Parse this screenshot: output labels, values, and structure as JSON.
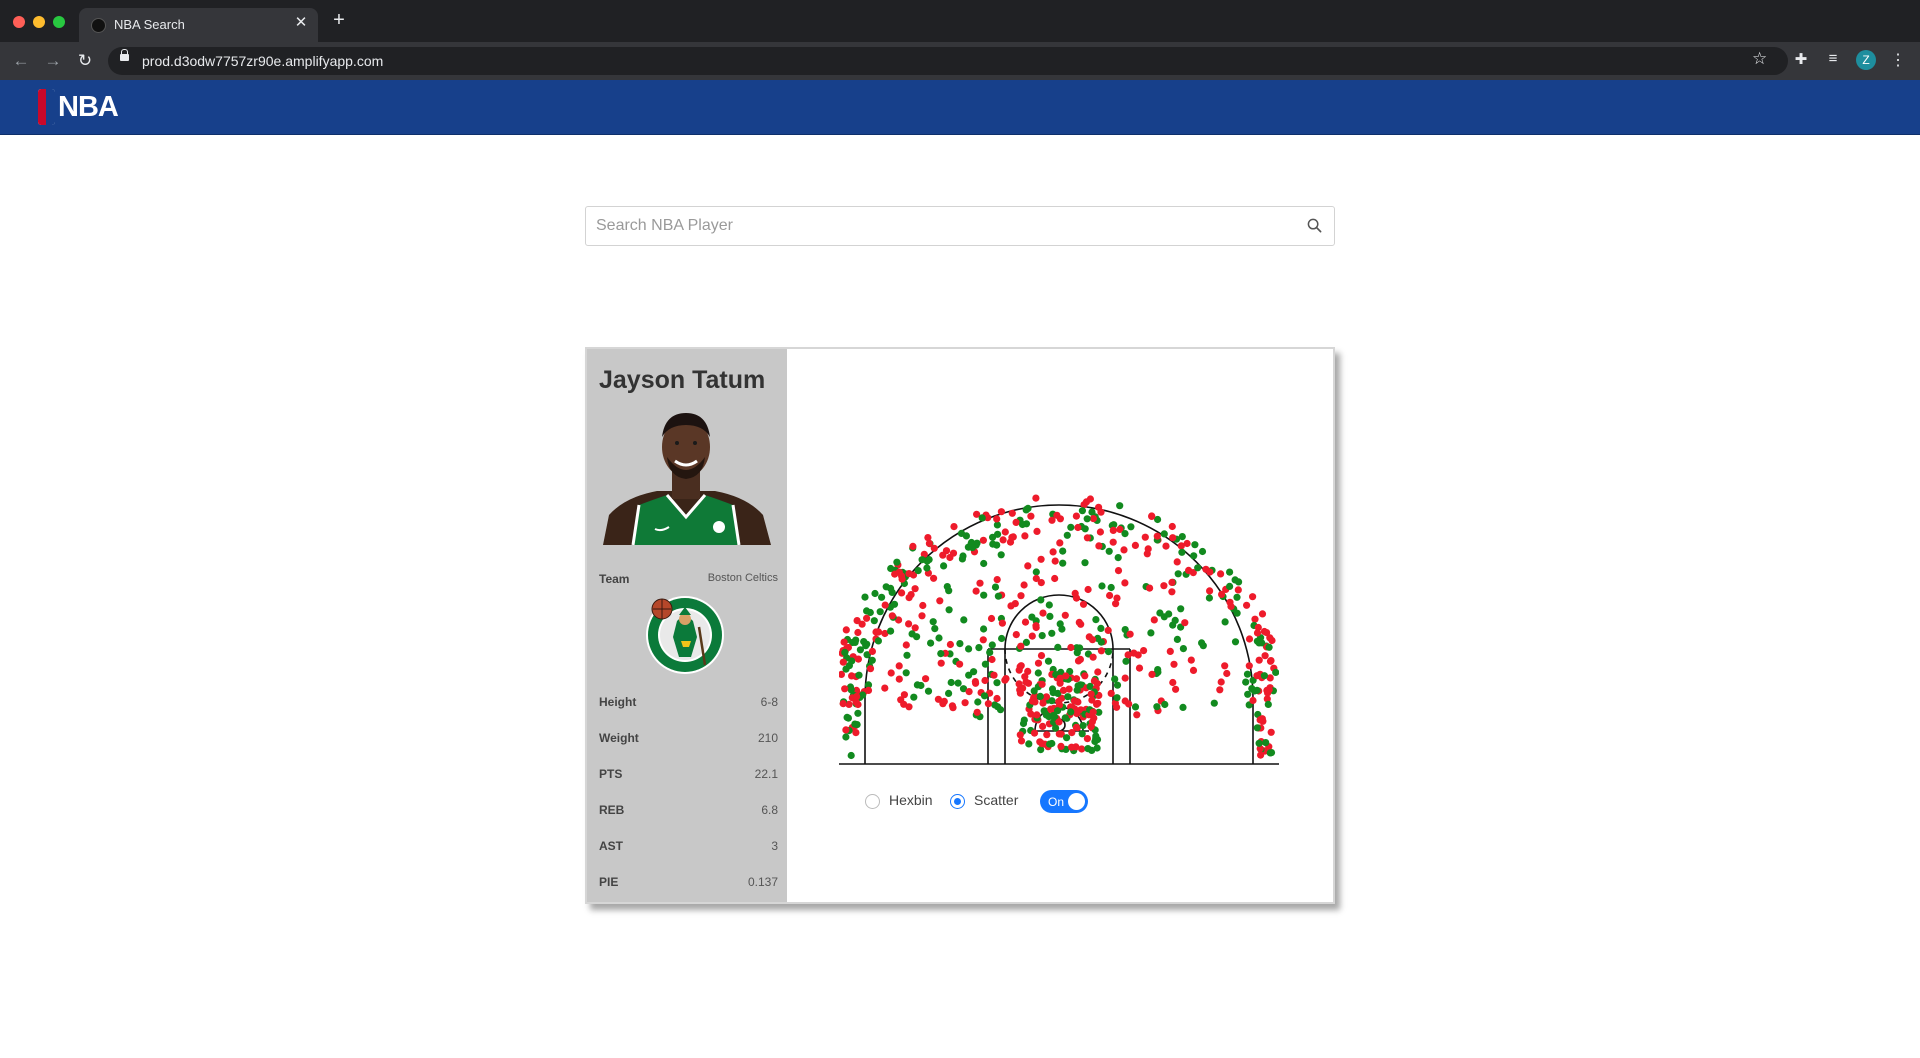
{
  "browser": {
    "tab_title": "NBA Search",
    "url": "prod.d3odw7757zr90e.amplifyapp.com",
    "profile_initial": "Z"
  },
  "header": {
    "logo_text": "NBA"
  },
  "search": {
    "placeholder": "Search NBA Player",
    "value": ""
  },
  "player": {
    "name": "Jayson Tatum",
    "team_label": "Team",
    "team": "Boston Celtics",
    "stats": [
      {
        "label": "Height",
        "value": "6-8"
      },
      {
        "label": "Weight",
        "value": "210"
      },
      {
        "label": "PTS",
        "value": "22.1"
      },
      {
        "label": "REB",
        "value": "6.8"
      },
      {
        "label": "AST",
        "value": "3"
      },
      {
        "label": "PIE",
        "value": "0.137"
      }
    ]
  },
  "chart_controls": {
    "hexbin_label": "Hexbin",
    "scatter_label": "Scatter",
    "selected": "Scatter",
    "toggle_label": "On",
    "toggle_on": true
  },
  "colors": {
    "made": "#128a1f",
    "missed": "#ee1b2b",
    "nba_blue": "#17408b",
    "accent": "#1677ff"
  }
}
